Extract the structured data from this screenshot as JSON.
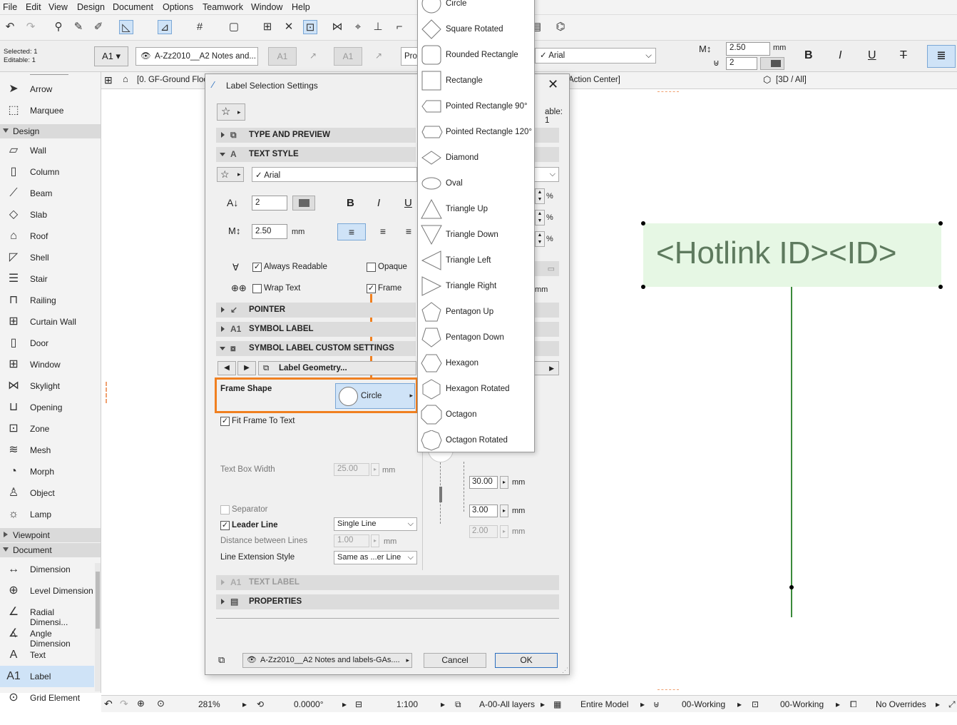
{
  "menu": [
    "File",
    "Edit",
    "View",
    "Design",
    "Document",
    "Options",
    "Teamwork",
    "Window",
    "Help"
  ],
  "info": {
    "selected": "Selected: 1",
    "editable": "Editable: 1"
  },
  "toolbar2": {
    "layer": "A-Zz2010__A2 Notes and...",
    "font": "Arial",
    "size": "2.50",
    "size_unit": "mm",
    "width": "2",
    "prop": "Prop",
    "bold": "B",
    "italic": "I",
    "underline": "U",
    "strike": "T",
    "label_tool": "A1"
  },
  "tabs": {
    "floor": "[0. GF-Ground Floo",
    "action": "Action Center]",
    "view3d": "[3D / All]"
  },
  "toolbox": {
    "top": [
      {
        "label": "Arrow",
        "icon": "arrow-icon"
      },
      {
        "label": "Marquee",
        "icon": "marquee-icon"
      }
    ],
    "design_title": "Design",
    "design": [
      {
        "label": "Wall",
        "icon": "wall-icon"
      },
      {
        "label": "Column",
        "icon": "column-icon"
      },
      {
        "label": "Beam",
        "icon": "beam-icon"
      },
      {
        "label": "Slab",
        "icon": "slab-icon"
      },
      {
        "label": "Roof",
        "icon": "roof-icon"
      },
      {
        "label": "Shell",
        "icon": "shell-icon"
      },
      {
        "label": "Stair",
        "icon": "stair-icon"
      },
      {
        "label": "Railing",
        "icon": "railing-icon"
      },
      {
        "label": "Curtain Wall",
        "icon": "curtain-wall-icon"
      },
      {
        "label": "Door",
        "icon": "door-icon"
      },
      {
        "label": "Window",
        "icon": "window-icon"
      },
      {
        "label": "Skylight",
        "icon": "skylight-icon"
      },
      {
        "label": "Opening",
        "icon": "opening-icon"
      },
      {
        "label": "Zone",
        "icon": "zone-icon"
      },
      {
        "label": "Mesh",
        "icon": "mesh-icon"
      },
      {
        "label": "Morph",
        "icon": "morph-icon"
      },
      {
        "label": "Object",
        "icon": "object-icon"
      },
      {
        "label": "Lamp",
        "icon": "lamp-icon"
      }
    ],
    "viewpoint_title": "Viewpoint",
    "document_title": "Document",
    "document": [
      {
        "label": "Dimension",
        "icon": "dimension-icon"
      },
      {
        "label": "Level Dimension",
        "icon": "level-dimension-icon"
      },
      {
        "label": "Radial Dimensi...",
        "icon": "radial-dimension-icon"
      },
      {
        "label": "Angle Dimension",
        "icon": "angle-dimension-icon"
      },
      {
        "label": "Text",
        "icon": "text-icon"
      },
      {
        "label": "Label",
        "icon": "label-icon"
      },
      {
        "label": "Grid Element",
        "icon": "grid-element-icon"
      }
    ]
  },
  "dialog": {
    "title": "Label Selection Settings",
    "editable_count": "able: 1",
    "panels": {
      "type_preview": "TYPE AND PREVIEW",
      "text_style": "TEXT STYLE",
      "pointer": "POINTER",
      "symbol_label": "SYMBOL LABEL",
      "custom": "SYMBOL LABEL CUSTOM SETTINGS",
      "text_label": "TEXT LABEL",
      "properties": "PROPERTIES"
    },
    "font": "Arial",
    "pen": "2",
    "text_size": "2.50",
    "mm": "mm",
    "pct": "%",
    "bold": "B",
    "italic": "I",
    "underline": "U",
    "always_readable": "Always Readable",
    "opaque": "Opaque",
    "wrap_text": "Wrap Text",
    "frame": "Frame",
    "geometry": "Label Geometry...",
    "frame_shape_label": "Frame Shape",
    "frame_shape_value": "Circle",
    "fit_frame": "Fit Frame To Text",
    "text_box_width": "Text Box Width",
    "text_box_width_value": "25.00",
    "separator": "Separator",
    "leader_line": "Leader Line",
    "leader_line_value": "Single Line",
    "distance_lines": "Distance between Lines",
    "distance_lines_value": "1.00",
    "line_ext": "Line Extension Style",
    "line_ext_value": "Same as ...er Line",
    "dim1": "30.00",
    "dim2": "3.00",
    "dim3": "2.00",
    "layer": "A-Zz2010__A2 Notes and labels-GAs....",
    "cancel": "Cancel",
    "ok": "OK"
  },
  "shapes": [
    "Circle",
    "Square Rotated",
    "Rounded Rectangle",
    "Rectangle",
    "Pointed Rectangle 90°",
    "Pointed Rectangle 120°",
    "Diamond",
    "Oval",
    "Triangle Up",
    "Triangle Down",
    "Triangle Left",
    "Triangle Right",
    "Pentagon Up",
    "Pentagon Down",
    "Hexagon",
    "Hexagon Rotated",
    "Octagon",
    "Octagon Rotated"
  ],
  "canvas": {
    "label_text": "<Hotlink ID><ID>",
    "highlight": "#f08020"
  },
  "status": {
    "zoom": "281%",
    "angle": "0.0000°",
    "scale": "1:100",
    "layers": "A-00-All layers",
    "model": "Entire Model",
    "pen1": "00-Working",
    "pen2": "00-Working",
    "overrides": "No Overrides"
  }
}
